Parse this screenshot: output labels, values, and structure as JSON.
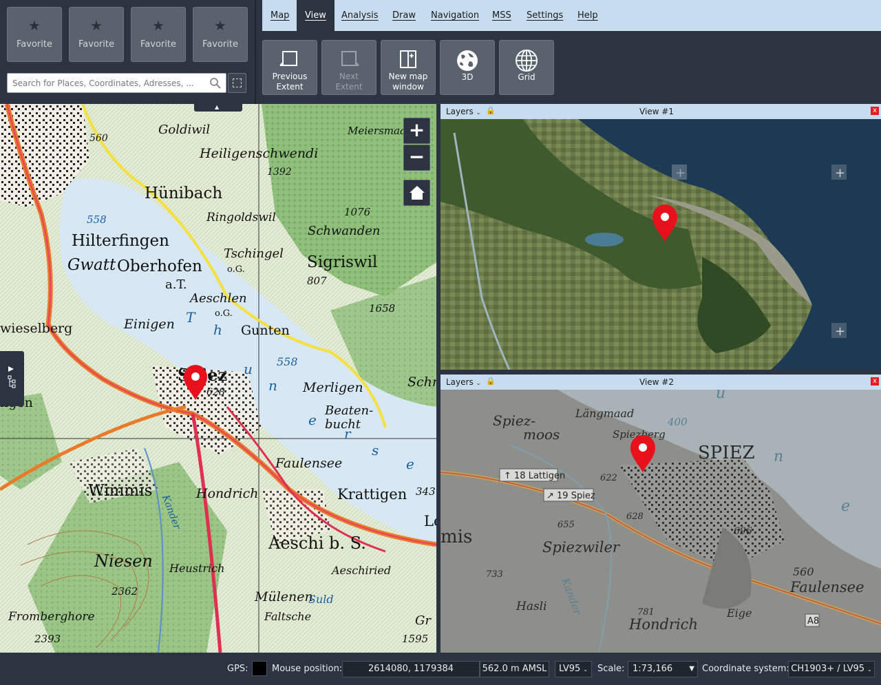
{
  "favorites": [
    {
      "label": "Favorite",
      "icon": "star-icon"
    },
    {
      "label": "Favorite",
      "icon": "star-icon"
    },
    {
      "label": "Favorite",
      "icon": "star-icon"
    },
    {
      "label": "Favorite",
      "icon": "star-icon"
    }
  ],
  "search": {
    "placeholder": "Search for Places, Coordinates, Adresses, ..."
  },
  "menu": {
    "items": [
      "Map",
      "View",
      "Analysis",
      "Draw",
      "Navigation",
      "MSS",
      "Settings",
      "Help"
    ],
    "active": "View"
  },
  "toolbar": {
    "buttons": [
      {
        "label_l1": "Previous",
        "label_l2": "Extent",
        "enabled": true,
        "icon": "previous-extent-icon"
      },
      {
        "label_l1": "Next",
        "label_l2": "Extent",
        "enabled": false,
        "icon": "next-extent-icon"
      },
      {
        "label_l1": "New map",
        "label_l2": "window",
        "enabled": true,
        "icon": "new-map-window-icon"
      },
      {
        "label_l1": "3D",
        "label_l2": "",
        "enabled": true,
        "icon": "globe-3d-icon"
      },
      {
        "label_l1": "Grid",
        "label_l2": "",
        "enabled": true,
        "icon": "grid-globe-icon"
      }
    ]
  },
  "main_map": {
    "place_labels": [
      "Goldiwil",
      "Meiersmaad",
      "Heiligenschwendi",
      "1392",
      "560",
      "Hünibach",
      "Ringoldswil",
      "1076",
      "Schwanden",
      "558",
      "Hilterfingen",
      "Tschingel",
      "o.G.",
      "Sigriswil",
      "Gwatt",
      "Oberhofen",
      "a.T.",
      "807",
      "Aeschlen",
      "o.G.",
      "1658",
      "Einigen",
      "Gunten",
      "wieselberg",
      "Spiez",
      "628",
      "558",
      "Merligen",
      "Beaten-",
      "bucht",
      "Schn",
      "ngen",
      "Faulensee",
      "Wimmis",
      "Hondrich",
      "Krattigen",
      "343",
      "Le",
      "Aeschi b. S.",
      "Niesen",
      "Heustrich",
      "Aeschiried",
      "2362",
      "Mülenen",
      "Suld",
      "Fromberghore",
      "Faltsche",
      "2393",
      "1595",
      "Thuner See",
      "Kander",
      "Gr"
    ]
  },
  "views": [
    {
      "title": "View #1",
      "layers_label": "Layers",
      "close_label": "x"
    },
    {
      "title": "View #2",
      "layers_label": "Layers",
      "close_label": "x"
    }
  ],
  "view2_labels": [
    "Spiez-",
    "moos",
    "Längmaad",
    "400",
    "Spiezberg",
    "SPIEZ",
    "18 Lattigen",
    "19 Spiez",
    "622",
    "628",
    "655",
    "696",
    "mis",
    "Spiezwiler",
    "Kander",
    "733",
    "560",
    "Faulensee",
    "Hasli",
    "781",
    "Hondrich",
    "Eige",
    "A8"
  ],
  "status": {
    "gps_label": "GPS:",
    "mouse_label": "Mouse position:",
    "mouse_value": "2614080, 1179384",
    "altitude": "562.0 m AMSL",
    "height_system": "LV95",
    "scale_label": "Scale:",
    "scale_value": "1:73,166",
    "crs_label": "Coordinate system:",
    "crs_value": "CH1903+ / LV95"
  },
  "colors": {
    "accent": "#c8dcf0",
    "panel": "#2b3440",
    "marker": "#e8101a"
  }
}
